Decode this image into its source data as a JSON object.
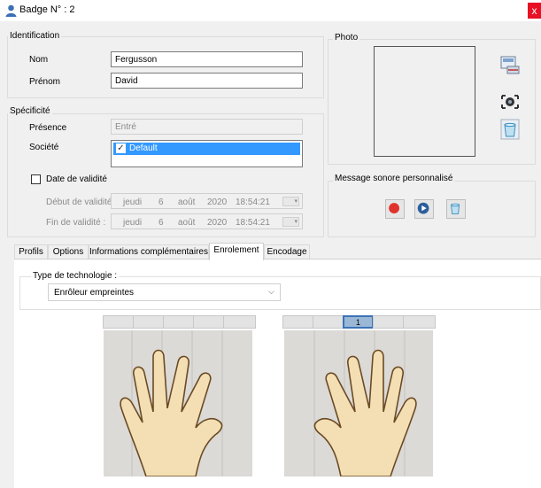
{
  "window": {
    "title": "Badge N° : 2",
    "close_label": "x"
  },
  "identification": {
    "group_label": "Identification",
    "nom_label": "Nom",
    "nom_value": "Fergusson",
    "prenom_label": "Prénom",
    "prenom_value": "David"
  },
  "photo": {
    "group_label": "Photo"
  },
  "specificite": {
    "group_label": "Spécificité",
    "presence_label": "Présence",
    "presence_value": "Entré",
    "societe_label": "Société",
    "societe_item": "Default",
    "societe_checked": true,
    "validity_label": "Date de validité",
    "debut_label": "Début de validité :",
    "fin_label": "Fin de validité :",
    "debut": {
      "day": "jeudi",
      "date": "6",
      "month": "août",
      "year": "2020",
      "time": "18:54:21"
    },
    "fin": {
      "day": "jeudi",
      "date": "6",
      "month": "août",
      "year": "2020",
      "time": "18:54:21"
    }
  },
  "message": {
    "group_label": "Message sonore personnalisé"
  },
  "tabs": [
    {
      "label": "Profils"
    },
    {
      "label": "Options"
    },
    {
      "label": "Informations complémentaires"
    },
    {
      "label": "Enrolement",
      "active": true
    },
    {
      "label": "Encodage"
    }
  ],
  "enrolement": {
    "tech_label": "Type de technologie :",
    "tech_value": "Enrôleur empreintes",
    "right_hand_selected_label": "1"
  },
  "colors": {
    "selection": "#3399ff",
    "record": "#e0322c",
    "play": "#2b5e9a",
    "skin": "#f4dfb5"
  }
}
